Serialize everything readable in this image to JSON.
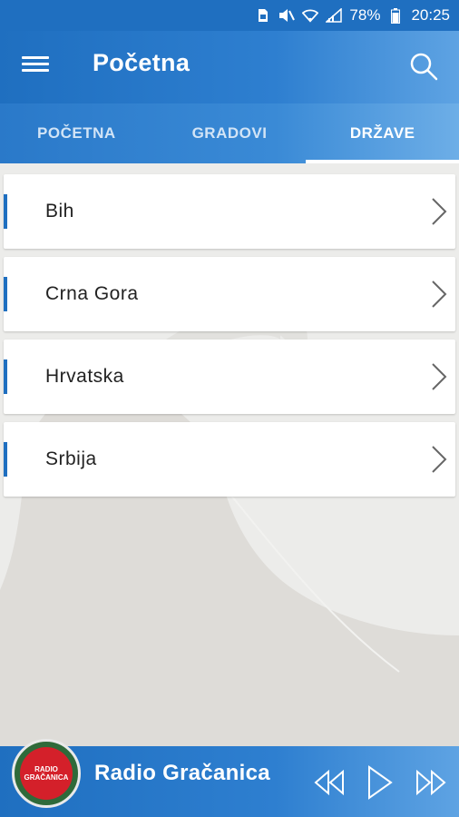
{
  "status_bar": {
    "battery_percent": "78%",
    "time": "20:25",
    "icons": [
      "sim-icon",
      "mute-icon",
      "wifi-icon",
      "signal-icon",
      "battery-icon"
    ]
  },
  "app_bar": {
    "title": "Početna",
    "menu_icon": "hamburger-menu-icon",
    "search_icon": "search-icon"
  },
  "tabs": [
    {
      "label": "POČETNA",
      "active": false
    },
    {
      "label": "GRADOVI",
      "active": false
    },
    {
      "label": "DRŽAVE",
      "active": true
    }
  ],
  "countries": [
    {
      "label": "Bih"
    },
    {
      "label": "Crna Gora"
    },
    {
      "label": "Hrvatska"
    },
    {
      "label": "Srbija"
    }
  ],
  "player": {
    "station_name": "Radio Gračanica",
    "logo_text_line1": "RADIO",
    "logo_text_line2": "GRAČANICA",
    "controls": [
      "rewind-icon",
      "play-icon",
      "fast-forward-icon"
    ]
  },
  "colors": {
    "primary": "#1f6fc0",
    "accent_bar": "#1f6fc0",
    "logo_red": "#d4202a",
    "logo_green": "#2f6a3a"
  }
}
